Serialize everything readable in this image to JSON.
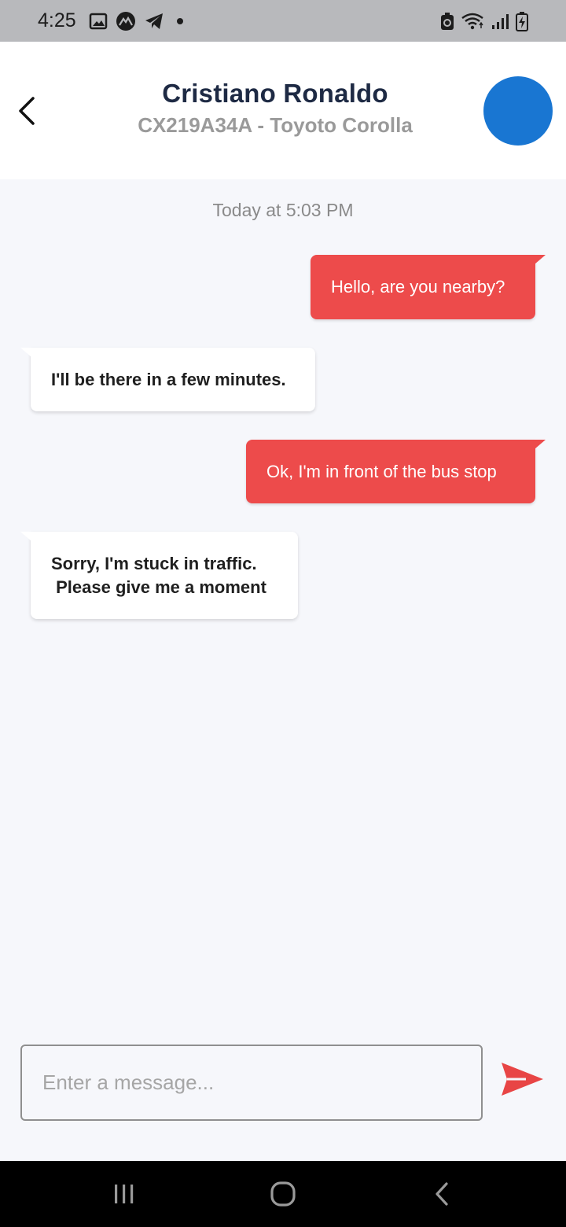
{
  "status_bar": {
    "time": "4:25",
    "left_icons": [
      "image-icon",
      "mountain-app-icon",
      "telegram-icon",
      "notification-dot-icon"
    ],
    "right_icons": [
      "recycle-battery-icon",
      "wifi-icon",
      "signal-icon",
      "battery-charging-icon"
    ]
  },
  "header": {
    "contact_name": "Cristiano Ronaldo",
    "vehicle_info": "CX219A34A - Toyoto Corolla",
    "avatar_color": "#1976d2"
  },
  "chat": {
    "timestamp": "Today at 5:03 PM",
    "messages": [
      {
        "direction": "outgoing",
        "text": "Hello, are you nearby?"
      },
      {
        "direction": "incoming",
        "text": "I'll be there in a few minutes."
      },
      {
        "direction": "outgoing",
        "text": "Ok, I'm in front of the bus stop"
      },
      {
        "direction": "incoming",
        "text": "Sorry, I'm stuck in traffic.\n Please give me a moment"
      }
    ]
  },
  "composer": {
    "placeholder": "Enter a message...",
    "value": ""
  },
  "colors": {
    "outgoing_bubble": "#ed4b4b",
    "incoming_bubble": "#ffffff",
    "send_icon": "#e84545",
    "background": "#f6f7fb"
  }
}
